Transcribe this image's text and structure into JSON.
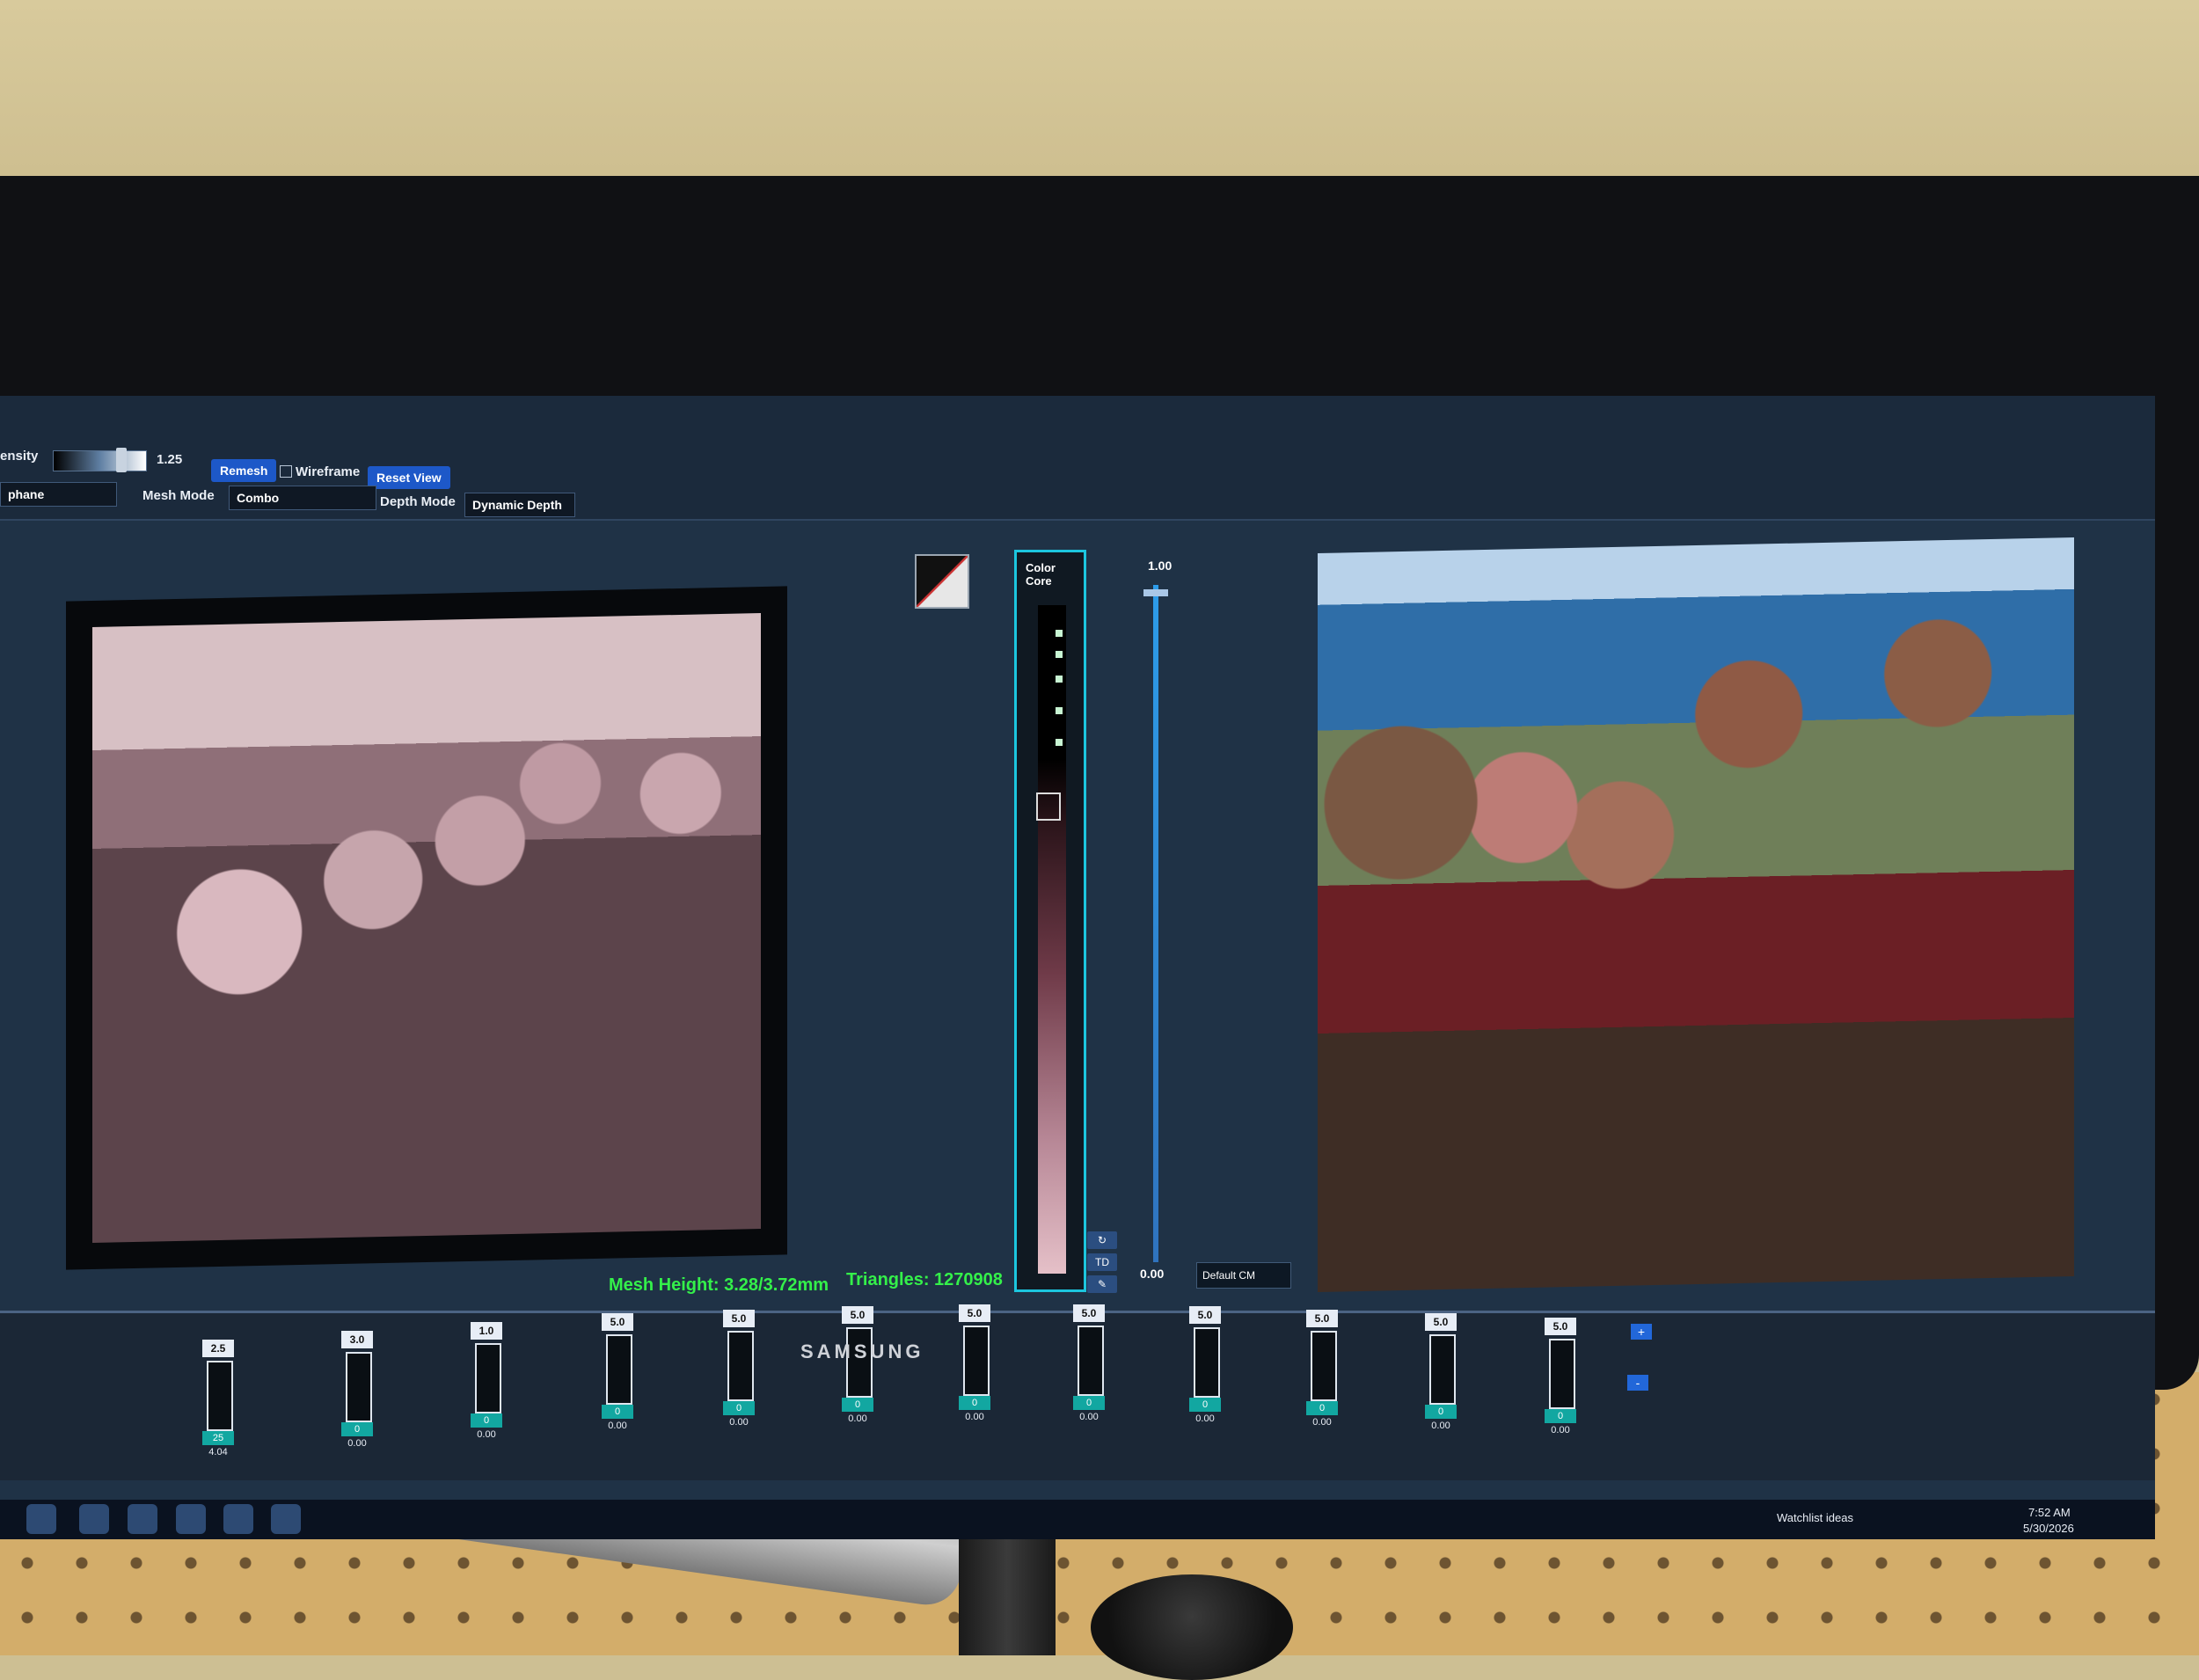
{
  "toolbar": {
    "density_label": "ensity",
    "density_value": "1.25",
    "remesh": "Remesh",
    "wireframe": "Wireframe",
    "reset_view": "Reset View",
    "mesh_mode_label": "Mesh Mode",
    "mesh_mode_value": "Combo",
    "depth_mode_label": "Depth Mode",
    "depth_mode_value": "Dynamic Depth",
    "left_select_value": "phane"
  },
  "status": {
    "mesh_height": "Mesh Height: 3.28/3.72mm",
    "triangles": "Triangles: 1270908"
  },
  "color_core": {
    "label": "Color Core"
  },
  "vertical_slider": {
    "top_value": "1.00",
    "bottom_value": "0.00"
  },
  "mini_buttons": {
    "td": "TD"
  },
  "colormap": {
    "value": "Default CM"
  },
  "channels": [
    {
      "top": "2.5",
      "value": "25",
      "bottom": "4.04"
    },
    {
      "top": "3.0",
      "value": "0",
      "bottom": "0.00"
    },
    {
      "top": "1.0",
      "value": "0",
      "bottom": "0.00"
    },
    {
      "top": "5.0",
      "value": "0",
      "bottom": "0.00"
    },
    {
      "top": "5.0",
      "value": "0",
      "bottom": "0.00"
    },
    {
      "top": "5.0",
      "value": "0",
      "bottom": "0.00"
    },
    {
      "top": "5.0",
      "value": "0",
      "bottom": "0.00"
    },
    {
      "top": "5.0",
      "value": "0",
      "bottom": "0.00"
    },
    {
      "top": "5.0",
      "value": "0",
      "bottom": "0.00"
    },
    {
      "top": "5.0",
      "value": "0",
      "bottom": "0.00"
    },
    {
      "top": "5.0",
      "value": "0",
      "bottom": "0.00"
    },
    {
      "top": "5.0",
      "value": "0",
      "bottom": "0.00"
    }
  ],
  "panel_buttons": {
    "plus": "+",
    "minus": "-"
  },
  "taskbar": {
    "notification": "Watchlist ideas",
    "time": "7:52 AM",
    "date": "5/30/2026"
  },
  "monitor": {
    "brand": "SAMSUNG"
  }
}
